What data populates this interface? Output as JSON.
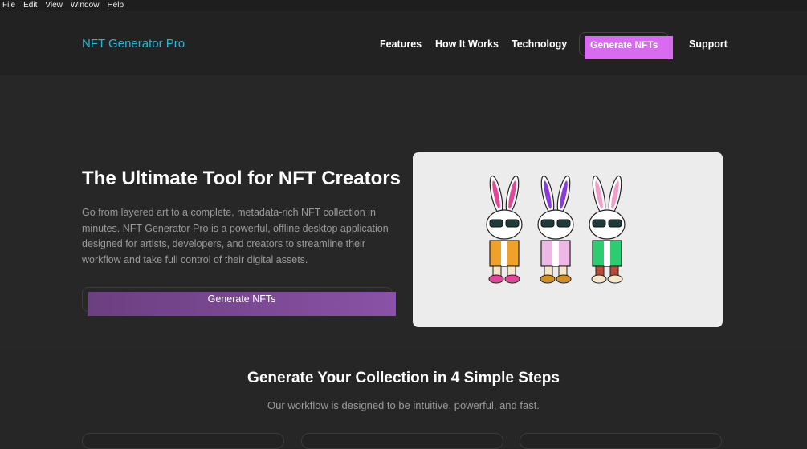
{
  "menubar": {
    "items": [
      "File",
      "Edit",
      "View",
      "Window",
      "Help"
    ]
  },
  "nav": {
    "brand": "NFT Generator Pro",
    "links": [
      "Features",
      "How It Works",
      "Technology"
    ],
    "cta": "Generate NFTs",
    "support": "Support"
  },
  "hero": {
    "title": "The Ultimate Tool for NFT Creators",
    "description": "Go from layered art to a complete, metadata-rich NFT collection in minutes. NFT Generator Pro is a powerful, offline desktop application designed for artists, developers, and creators to streamline their workflow and take full control of their digital assets.",
    "cta": "Generate NFTs"
  },
  "steps": {
    "title": "Generate Your Collection in 4 Simple Steps",
    "subtitle": "Our workflow is designed to be intuitive, powerful, and fast."
  },
  "colors": {
    "brand": "#2bb5d0",
    "nav_cta": "#d86bf0",
    "hero_cta": "#7a4896",
    "background": "#262626"
  }
}
